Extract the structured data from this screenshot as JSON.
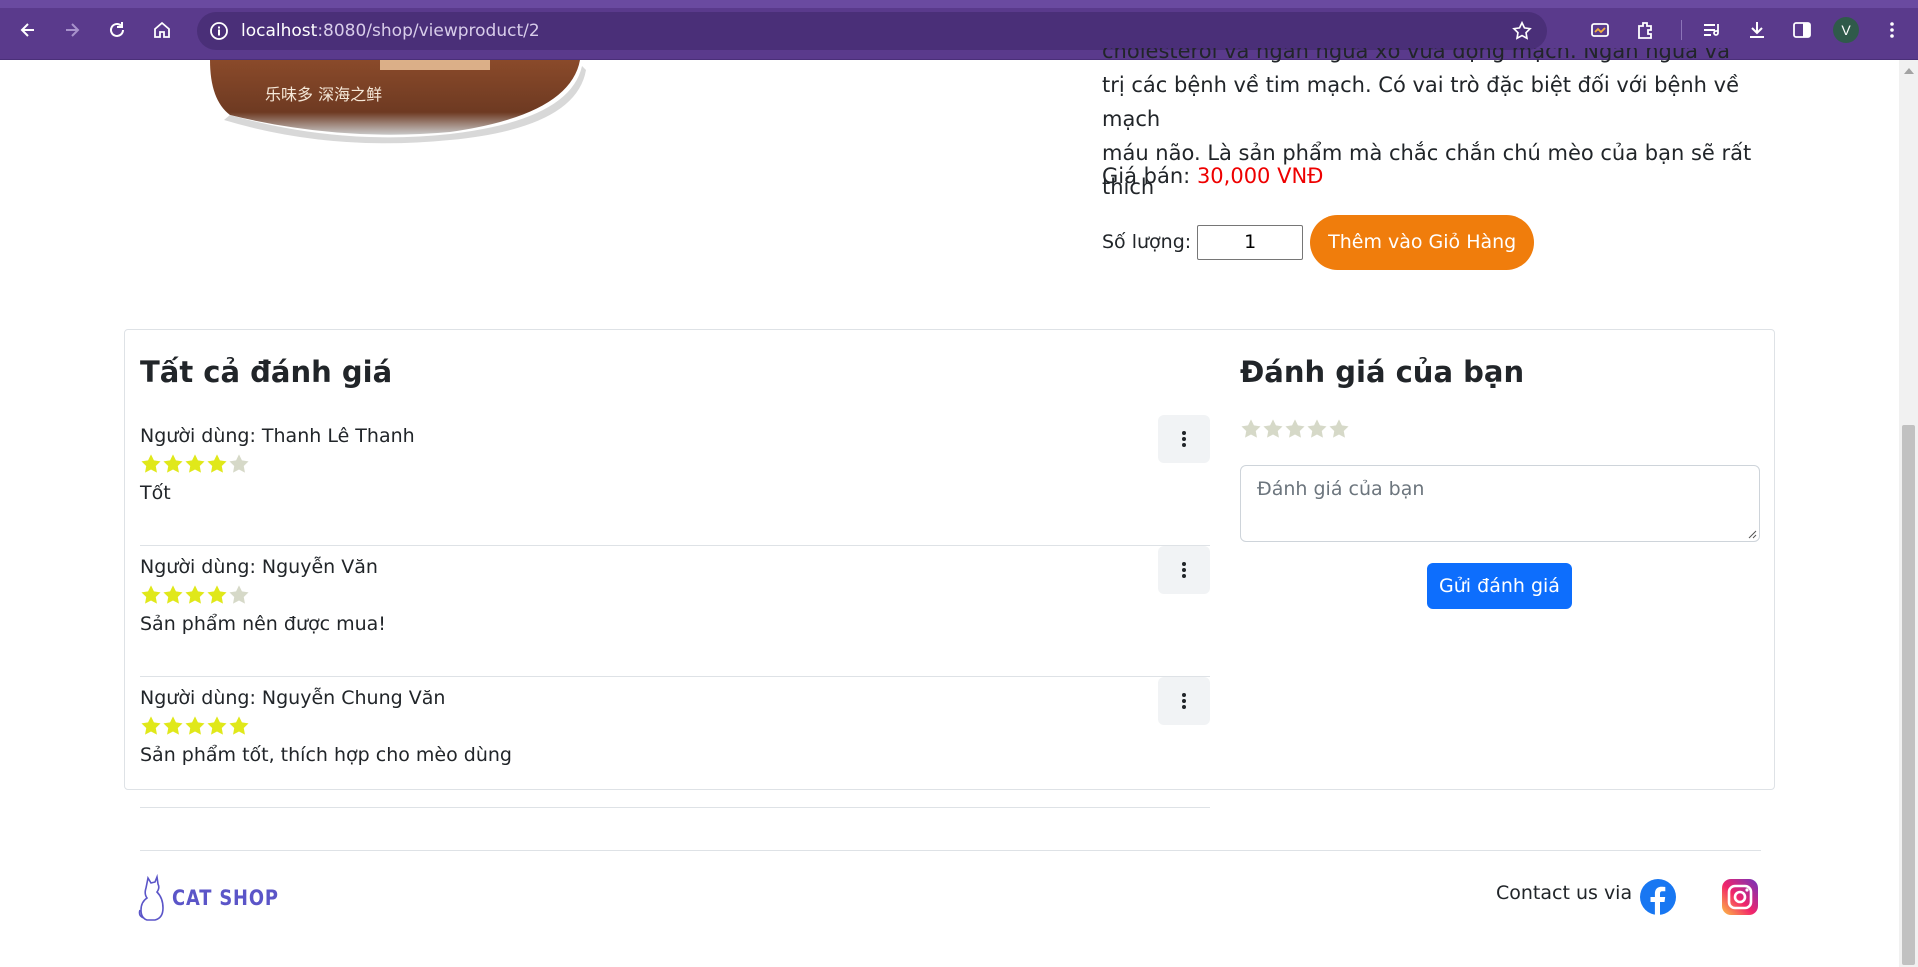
{
  "browser": {
    "url_host": "localhost",
    "url_rest": ":8080/shop/viewproduct/2",
    "profile_initial": "V"
  },
  "product": {
    "description_partial_line": "cholesterol và ngăn ngừa xơ vữa động mạch. Ngăn ngừa và điều",
    "description_lines": [
      "trị các bệnh về tim mạch. Có vai trò đặc biệt đối với bệnh về mạch",
      "máu não. Là sản phẩm mà chắc chắn chú mèo của bạn sẽ rất thích"
    ],
    "price_label": "Giá bán:",
    "price_value": "30,000 VNĐ",
    "quantity_label": "Số lượng:",
    "quantity_value": "1",
    "add_to_cart_label": "Thêm vào Giỏ Hàng",
    "image_text": "乐味多 深海之鲜"
  },
  "reviews": {
    "title": "Tất cả đánh giá",
    "items": [
      {
        "user": "Người dùng: Thanh Lê Thanh",
        "rating": 4,
        "text": "Tốt"
      },
      {
        "user": "Người dùng: Nguyễn Văn",
        "rating": 4,
        "text": "Sản phẩm nên được mua!"
      },
      {
        "user": "Người dùng: Nguyễn Chung Văn",
        "rating": 5,
        "text": "Sản phẩm tốt, thích hợp cho mèo dùng"
      }
    ]
  },
  "my_review": {
    "title": "Đánh giá của bạn",
    "rating": 0,
    "placeholder": "Đánh giá của bạn",
    "submit_label": "Gửi đánh giá"
  },
  "footer": {
    "brand": "CAT SHOP",
    "contact_label": "Contact us via"
  },
  "colors": {
    "star_on": "#e0e81a",
    "star_off": "#d6d9c8",
    "price": "#ee0000",
    "add_to_cart": "#f07d0c",
    "submit": "#0d6efd",
    "brand": "#5b55c8"
  }
}
